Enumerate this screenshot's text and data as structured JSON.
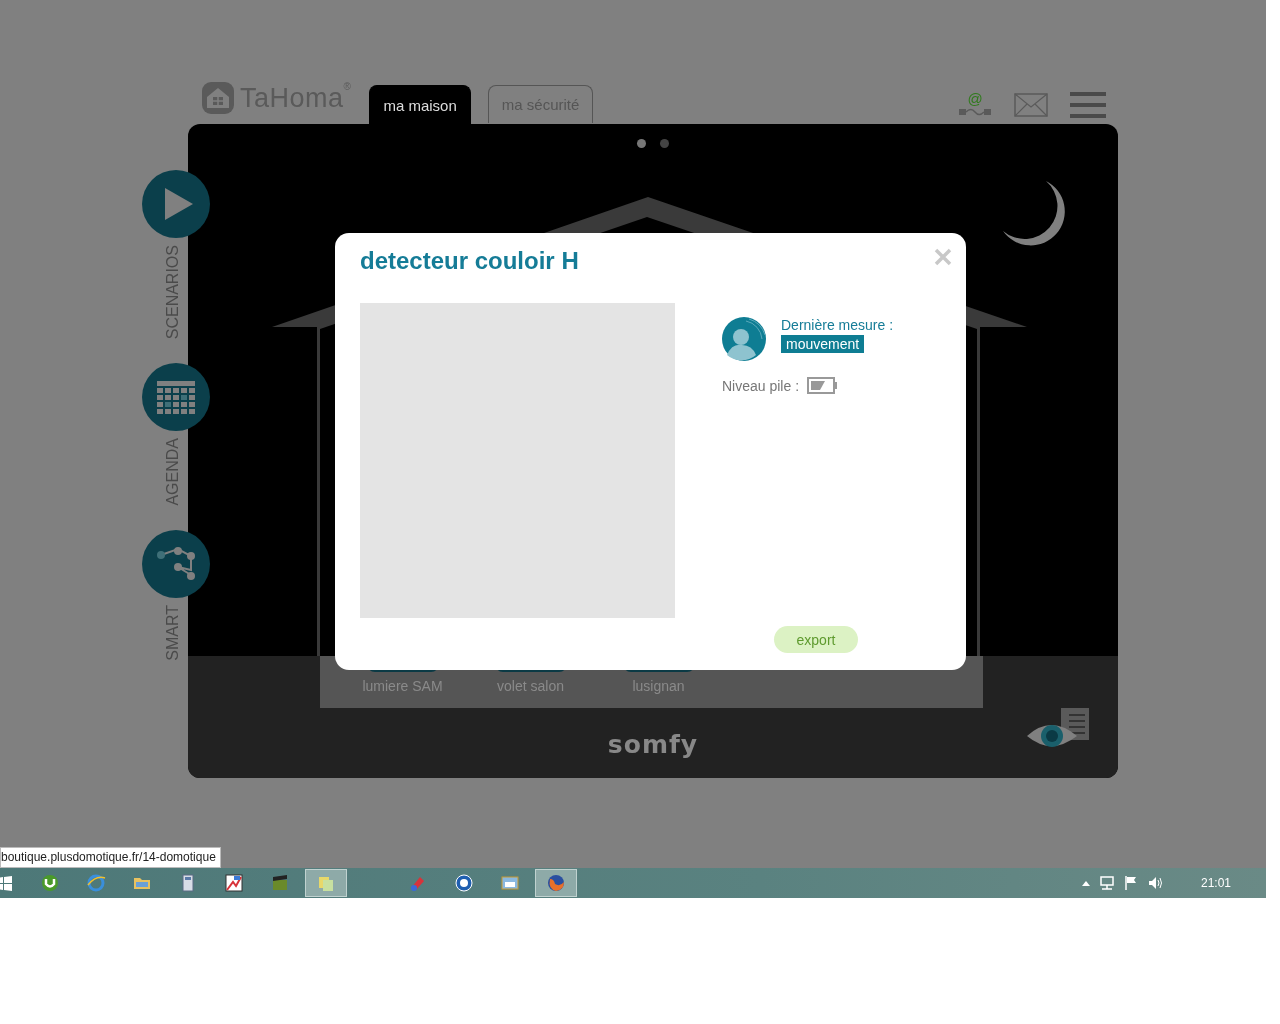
{
  "logo": {
    "text": "TaHoma",
    "mark": "®"
  },
  "connection_symbol": "@",
  "tabs": [
    {
      "label": "ma maison",
      "selected": true
    },
    {
      "label": "ma sécurité",
      "selected": false
    }
  ],
  "pager": [
    {
      "selected": true
    },
    {
      "selected": false
    }
  ],
  "side_menu": [
    {
      "label": "SCENARIOS",
      "kind": "play"
    },
    {
      "label": "AGENDA",
      "kind": "calendar"
    },
    {
      "label": "SMART",
      "kind": "network"
    }
  ],
  "devices": [
    {
      "label": "lumiere SAM"
    },
    {
      "label": "volet salon"
    },
    {
      "label": "lusignan"
    }
  ],
  "brand": "somfy",
  "modal": {
    "title": "detecteur couloir H",
    "measure_label": "Dernière mesure :",
    "measure_value": "mouvement",
    "battery_label": "Niveau pile :",
    "export_button": "export"
  },
  "status_url": "boutique.plusdomotique.fr/14-domotique",
  "taskbar": {
    "apps": [
      {
        "kind": "start",
        "selected": false
      },
      {
        "kind": "torrent",
        "selected": false
      },
      {
        "kind": "browser",
        "selected": false
      },
      {
        "kind": "folder",
        "selected": false
      },
      {
        "kind": "calculator",
        "selected": false
      },
      {
        "kind": "paint",
        "selected": false
      },
      {
        "kind": "clapper",
        "selected": false
      },
      {
        "kind": "files",
        "selected": true
      },
      {
        "kind": "tools",
        "selected": false
      },
      {
        "kind": "media",
        "selected": false
      },
      {
        "kind": "window",
        "selected": false
      },
      {
        "kind": "firefox",
        "selected": true
      }
    ],
    "clock": "21:01"
  }
}
